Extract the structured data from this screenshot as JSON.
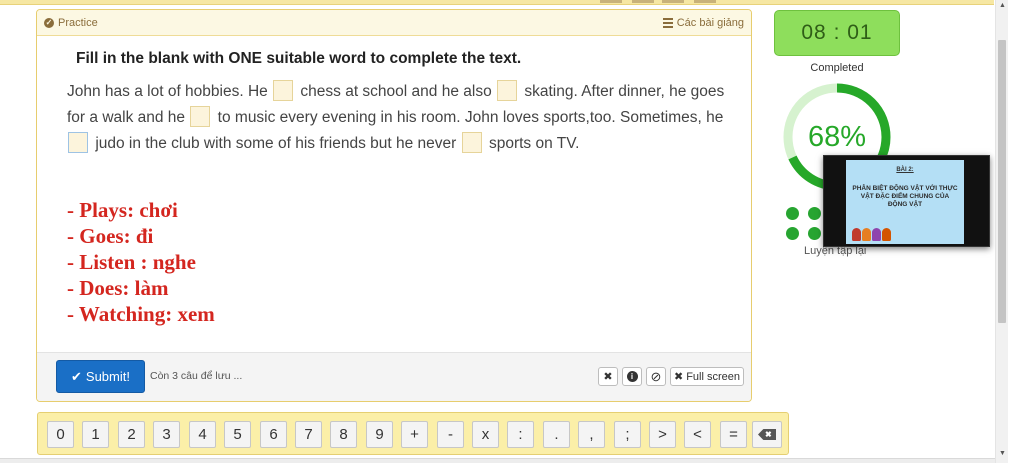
{
  "card": {
    "header_left": "Practice",
    "header_right": "Các bài giảng"
  },
  "question": {
    "instruction": "Fill in the blank with ONE suitable word to complete the text.",
    "passage": [
      "John has a lot of hobbies. He",
      "chess at school and he also",
      "skating. After dinner, he goes for a walk and he",
      "to music every evening in his room. John loves sports,too. Sometimes, he",
      "judo in the club with some of his friends but he never",
      "sports on TV."
    ]
  },
  "answers": [
    "- Plays: chơi",
    "- Goes: đi",
    "- Listen : nghe",
    "- Does: làm",
    "- Watching: xem"
  ],
  "footer": {
    "submit_label": "Submit!",
    "save_note": "Còn 3 câu để lưu ...",
    "close_glyph": "✖",
    "info_glyph": "i",
    "skip_glyph": "⊘",
    "fullscreen_label": "Full screen",
    "fullscreen_glyph": "✖"
  },
  "keyboard": {
    "keys": [
      "0",
      "1",
      "2",
      "3",
      "4",
      "5",
      "6",
      "7",
      "8",
      "9",
      "+",
      "-",
      "x",
      ":",
      ".",
      ",",
      ";",
      ">",
      "<",
      "="
    ],
    "backspace_glyph": "✖"
  },
  "sidebar": {
    "timer": "08 : 01",
    "completed_label": "Completed",
    "progress_percent": "68%",
    "progress_value": 0.68,
    "retry_label": "Luyện tập lại"
  },
  "video": {
    "slide_label": "BÀI 2:",
    "slide_title": "PHÂN BIỆT ĐỘNG VẬT VỚI THỰC VẬT ĐẶC ĐIỂM CHUNG CỦA ĐỘNG VẬT"
  },
  "colors": {
    "accent_blue": "#1a6fc6",
    "timer_green": "#8ede5c",
    "progress_green": "#26a829",
    "answer_red": "#d4261f",
    "panel_yellow": "#fcf8e3"
  },
  "icons": {
    "practice": "check-circle-icon",
    "lessons": "list-icon",
    "submit": "check-icon",
    "backspace": "backspace-icon"
  }
}
